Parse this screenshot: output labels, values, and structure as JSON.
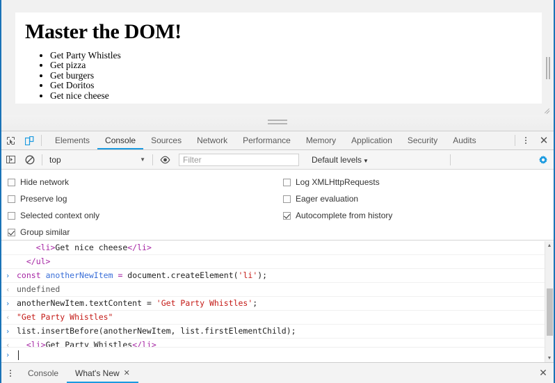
{
  "page": {
    "heading": "Master the DOM!",
    "list_items": [
      "Get Party Whistles",
      "Get pizza",
      "Get burgers",
      "Get Doritos",
      "Get nice cheese"
    ]
  },
  "devtools": {
    "main_tabs": [
      {
        "label": "Elements",
        "active": false
      },
      {
        "label": "Console",
        "active": true
      },
      {
        "label": "Sources",
        "active": false
      },
      {
        "label": "Network",
        "active": false
      },
      {
        "label": "Performance",
        "active": false
      },
      {
        "label": "Memory",
        "active": false
      },
      {
        "label": "Application",
        "active": false
      },
      {
        "label": "Security",
        "active": false
      },
      {
        "label": "Audits",
        "active": false
      }
    ],
    "icons": {
      "inspect": "inspect-element-icon",
      "device": "device-toolbar-icon",
      "more": "more-options-icon",
      "close": "close-icon",
      "sidebar": "console-sidebar-icon",
      "clear": "clear-console-icon",
      "eye": "live-expression-icon",
      "settings": "settings-gear-icon"
    },
    "close_label": "✕",
    "console_toolbar": {
      "context": "top",
      "context_caret": "▼",
      "filter_placeholder": "Filter",
      "filter_value": "",
      "levels_label": "Default levels",
      "levels_caret": "▼"
    },
    "settings_panel": {
      "left": [
        {
          "label": "Hide network",
          "checked": false
        },
        {
          "label": "Preserve log",
          "checked": false
        },
        {
          "label": "Selected context only",
          "checked": false
        },
        {
          "label": "Group similar",
          "checked": true
        }
      ],
      "right": [
        {
          "label": "Log XMLHttpRequests",
          "checked": false
        },
        {
          "label": "Eager evaluation",
          "checked": false
        },
        {
          "label": "Autocomplete from history",
          "checked": true
        }
      ]
    },
    "console_messages": [
      {
        "type": "output-continued",
        "gutter": "",
        "tokens": [
          {
            "t": "    ",
            "c": "plain"
          },
          {
            "t": "<li>",
            "c": "tag"
          },
          {
            "t": "Get nice cheese",
            "c": "plain"
          },
          {
            "t": "</li>",
            "c": "tag"
          }
        ]
      },
      {
        "type": "output-continued",
        "gutter": "",
        "tokens": [
          {
            "t": "  ",
            "c": "plain"
          },
          {
            "t": "</ul>",
            "c": "tag"
          }
        ]
      },
      {
        "type": "input",
        "gutter": "›",
        "tokens": [
          {
            "t": "const",
            "c": "kw"
          },
          {
            "t": " ",
            "c": "plain"
          },
          {
            "t": "anotherNewItem",
            "c": "var"
          },
          {
            "t": " ",
            "c": "plain"
          },
          {
            "t": "=",
            "c": "kw"
          },
          {
            "t": " document.createElement(",
            "c": "plain"
          },
          {
            "t": "'li'",
            "c": "str"
          },
          {
            "t": ");",
            "c": "plain"
          }
        ]
      },
      {
        "type": "output",
        "gutter": "‹",
        "tokens": [
          {
            "t": "undefined",
            "c": "gray"
          }
        ]
      },
      {
        "type": "input",
        "gutter": "›",
        "tokens": [
          {
            "t": "anotherNewItem.textContent",
            "c": "plain"
          },
          {
            "t": " = ",
            "c": "plain"
          },
          {
            "t": "'Get Party Whistles'",
            "c": "str"
          },
          {
            "t": ";",
            "c": "plain"
          }
        ]
      },
      {
        "type": "output",
        "gutter": "‹",
        "tokens": [
          {
            "t": "\"Get Party Whistles\"",
            "c": "str"
          }
        ]
      },
      {
        "type": "input",
        "gutter": "›",
        "tokens": [
          {
            "t": "list.insertBefore(anotherNewItem, list.firstElementChild);",
            "c": "plain"
          }
        ]
      },
      {
        "type": "output",
        "gutter": "‹",
        "tokens": [
          {
            "t": "  ",
            "c": "plain"
          },
          {
            "t": "<li>",
            "c": "tag"
          },
          {
            "t": "Get Party Whistles",
            "c": "plain"
          },
          {
            "t": "</li>",
            "c": "tag"
          }
        ]
      }
    ],
    "prompt": {
      "caret": "›",
      "value": ""
    },
    "drawer_tabs": [
      {
        "label": "Console",
        "active": false,
        "closable": false
      },
      {
        "label": "What's New",
        "active": true,
        "closable": true
      }
    ],
    "drawer_close_glyph": "✕",
    "drawer_tab_close_glyph": "✕"
  },
  "colors": {
    "accent_blue": "#1a9ae0",
    "window_border": "#1a73b7",
    "string_red": "#c41a16",
    "keyword_purple": "#a626a4",
    "variable_blue": "#3a6fd8"
  }
}
